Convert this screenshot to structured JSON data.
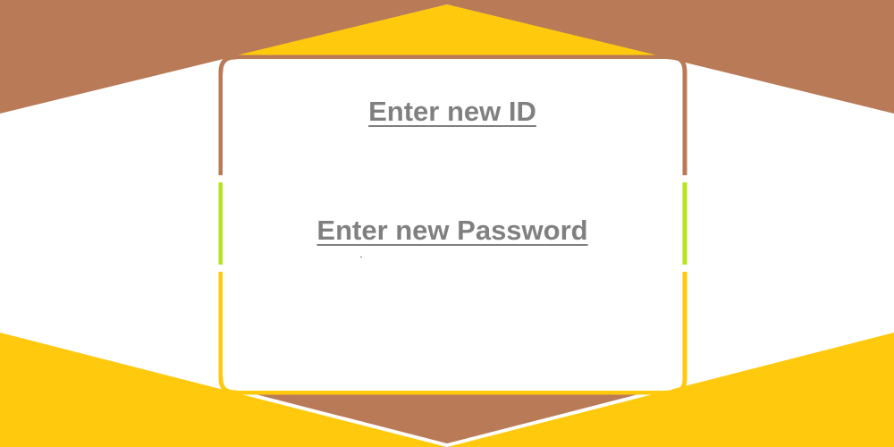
{
  "form": {
    "id_label": "Enter new ID",
    "password_label": "Enter new Password"
  },
  "colors": {
    "brown": "#b97a57",
    "yellow": "#ffc90e",
    "lime": "#b5e61d",
    "text": "#808080",
    "background": "#ffffff"
  }
}
